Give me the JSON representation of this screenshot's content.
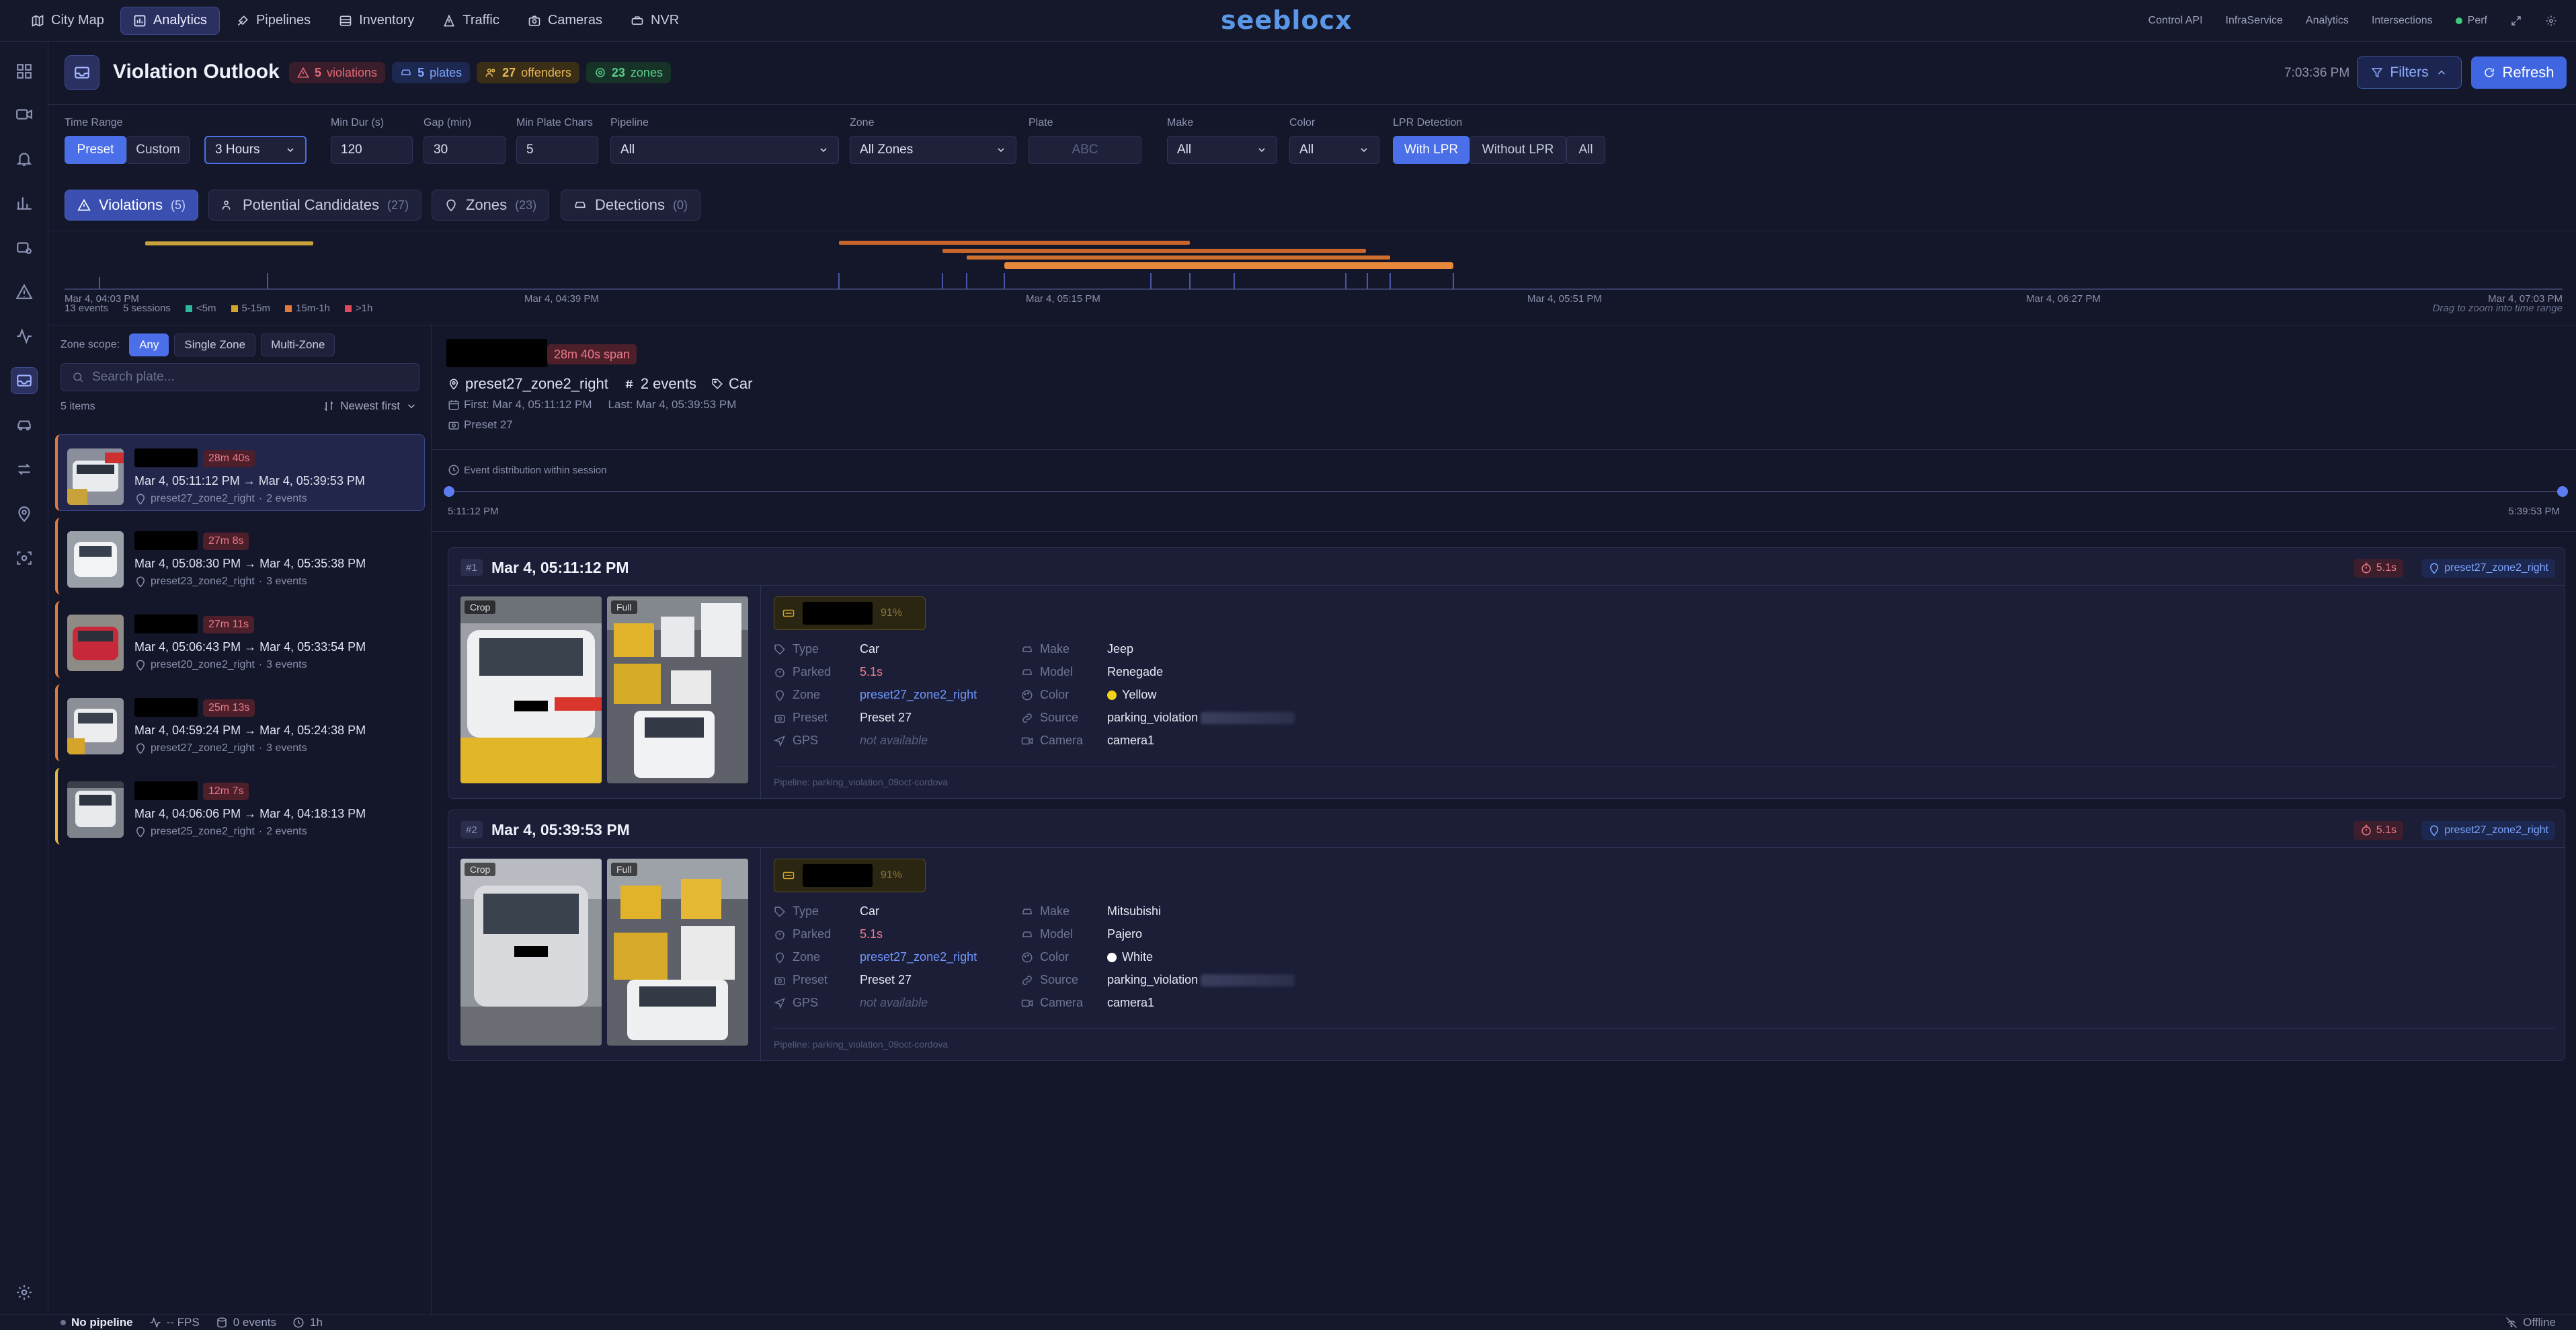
{
  "nav": {
    "items": [
      {
        "label": "City Map",
        "icon": "map-icon",
        "active": false
      },
      {
        "label": "Analytics",
        "icon": "chart-icon",
        "active": true
      },
      {
        "label": "Pipelines",
        "icon": "pipeline-icon",
        "active": false
      },
      {
        "label": "Inventory",
        "icon": "inventory-icon",
        "active": false
      },
      {
        "label": "Traffic",
        "icon": "traffic-icon",
        "active": false
      },
      {
        "label": "Cameras",
        "icon": "camera-icon",
        "active": false
      },
      {
        "label": "NVR",
        "icon": "nvr-icon",
        "active": false
      }
    ],
    "logo": "seeblocx",
    "right": {
      "control_api": "Control API",
      "infraservice": "InfraService",
      "analytics": "Analytics",
      "intersections": "Intersections",
      "perf": "Perf"
    }
  },
  "header": {
    "title": "Violation Outlook",
    "badges": {
      "violations": {
        "count": "5",
        "label": "violations"
      },
      "plates": {
        "count": "5",
        "label": "plates"
      },
      "offenders": {
        "count": "27",
        "label": "offenders"
      },
      "zones": {
        "count": "23",
        "label": "zones"
      }
    },
    "clock": "7:03:36 PM",
    "filters_label": "Filters",
    "refresh_label": "Refresh"
  },
  "filters": {
    "time_range": {
      "label": "Time Range",
      "preset": "Preset",
      "custom": "Custom",
      "value": "3 Hours"
    },
    "min_dur": {
      "label": "Min Dur (s)",
      "value": "120"
    },
    "gap": {
      "label": "Gap (min)",
      "value": "30"
    },
    "min_plate_chars": {
      "label": "Min Plate Chars",
      "value": "5"
    },
    "pipeline": {
      "label": "Pipeline",
      "value": "All"
    },
    "zone": {
      "label": "Zone",
      "value": "All Zones"
    },
    "plate": {
      "label": "Plate",
      "placeholder": "ABC"
    },
    "make": {
      "label": "Make",
      "value": "All"
    },
    "color": {
      "label": "Color",
      "value": "All"
    },
    "lpr": {
      "label": "LPR Detection",
      "with": "With LPR",
      "without": "Without LPR",
      "all": "All"
    }
  },
  "tabs": [
    {
      "label": "Violations",
      "count": "(5)"
    },
    {
      "label": "Potential Candidates",
      "count": "(27)"
    },
    {
      "label": "Zones",
      "count": "(23)"
    },
    {
      "label": "Detections",
      "count": "(0)"
    }
  ],
  "timeline": {
    "ticks": [
      "Mar 4, 04:03 PM",
      "Mar 4, 04:39 PM",
      "Mar 4, 05:15 PM",
      "Mar 4, 05:51 PM",
      "Mar 4, 06:27 PM",
      "Mar 4, 07:03 PM"
    ],
    "events": "13 events",
    "sessions": "5 sessions",
    "legend": [
      {
        "label": "<5m",
        "color": "#2fb89a"
      },
      {
        "label": "5-15m",
        "color": "#d4a52a"
      },
      {
        "label": "15m-1h",
        "color": "#e07a3a"
      },
      {
        "label": ">1h",
        "color": "#e0485c"
      }
    ],
    "hint": "Drag to zoom into time range"
  },
  "list": {
    "scope_label": "Zone scope:",
    "scope_options": [
      "Any",
      "Single Zone",
      "Multi-Zone"
    ],
    "search_placeholder": "Search plate...",
    "count": "5 items",
    "sort": "Newest first",
    "items": [
      {
        "duration": "28m 40s",
        "time": "Mar 4, 05:11:12 PM → Mar 4, 05:39:53 PM",
        "zone": "preset27_zone2_right",
        "events": "2 events"
      },
      {
        "duration": "27m 8s",
        "time": "Mar 4, 05:08:30 PM → Mar 4, 05:35:38 PM",
        "zone": "preset23_zone2_right",
        "events": "3 events"
      },
      {
        "duration": "27m 11s",
        "time": "Mar 4, 05:06:43 PM → Mar 4, 05:33:54 PM",
        "zone": "preset20_zone2_right",
        "events": "3 events"
      },
      {
        "duration": "25m 13s",
        "time": "Mar 4, 04:59:24 PM → Mar 4, 05:24:38 PM",
        "zone": "preset27_zone2_right",
        "events": "3 events"
      },
      {
        "duration": "12m 7s",
        "time": "Mar 4, 04:06:06 PM → Mar 4, 04:18:13 PM",
        "zone": "preset25_zone2_right",
        "events": "2 events"
      }
    ]
  },
  "detail": {
    "span": "28m 40s span",
    "zone": "preset27_zone2_right",
    "events": "2 events",
    "type": "Car",
    "first": "First: Mar 4, 05:11:12 PM",
    "last": "Last: Mar 4, 05:39:53 PM",
    "preset": "Preset 27",
    "dist_label": "Event distribution within session",
    "dist_start": "5:11:12 PM",
    "dist_end": "5:39:53 PM",
    "events_list": [
      {
        "num": "#1",
        "time": "Mar 4, 05:11:12 PM",
        "parked_badge": "5.1s",
        "zone_badge": "preset27_zone2_right",
        "confidence": "91%",
        "fields": {
          "type": "Car",
          "parked": "5.1s",
          "zone": "preset27_zone2_right",
          "preset": "Preset 27",
          "gps": "not available",
          "make": "Jeep",
          "model": "Renegade",
          "color": "Yellow",
          "source": "parking_violation",
          "camera": "camera1"
        },
        "color_hex": "#f2d21b",
        "pipeline": "Pipeline: parking_violation_09oct-cordova"
      },
      {
        "num": "#2",
        "time": "Mar 4, 05:39:53 PM",
        "parked_badge": "5.1s",
        "zone_badge": "preset27_zone2_right",
        "confidence": "91%",
        "fields": {
          "type": "Car",
          "parked": "5.1s",
          "zone": "preset27_zone2_right",
          "preset": "Preset 27",
          "gps": "not available",
          "make": "Mitsubishi",
          "model": "Pajero",
          "color": "White",
          "source": "parking_violation",
          "camera": "camera1"
        },
        "color_hex": "#ffffff",
        "pipeline": "Pipeline: parking_violation_09oct-cordova"
      }
    ],
    "labels": {
      "type": "Type",
      "parked": "Parked",
      "zone": "Zone",
      "preset": "Preset",
      "gps": "GPS",
      "make": "Make",
      "model": "Model",
      "color": "Color",
      "source": "Source",
      "camera": "Camera",
      "crop": "Crop",
      "full": "Full"
    }
  },
  "status": {
    "pipeline": "No pipeline",
    "fps": "-- FPS",
    "events": "0 events",
    "window": "1h",
    "offline": "Offline"
  }
}
